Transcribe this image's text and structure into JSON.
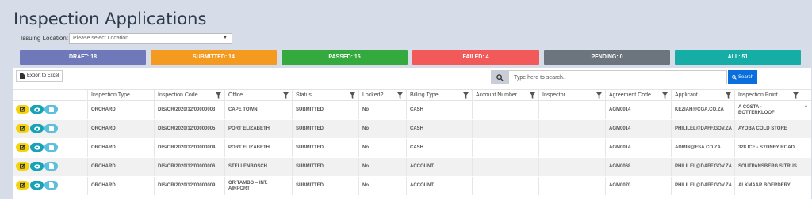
{
  "page": {
    "title": "Inspection Applications"
  },
  "filters": {
    "issuing_location_label": "Issuing Location:",
    "issuing_location_placeholder": "Please select Location"
  },
  "summary_cards": [
    {
      "label": "DRAFT: 18",
      "color": "#6f78b9"
    },
    {
      "label": "SUBMITTED: 14",
      "color": "#f49b1f"
    },
    {
      "label": "PASSED: 15",
      "color": "#33a93e"
    },
    {
      "label": "FAILED: 4",
      "color": "#f25a5a"
    },
    {
      "label": "PENDING: 0",
      "color": "#6c757d"
    },
    {
      "label": "ALL: 51",
      "color": "#15ada5"
    }
  ],
  "toolbar": {
    "export_label": "Export to Excel",
    "search_placeholder": "Type here to search..",
    "search_button_label": "Search"
  },
  "table": {
    "columns": [
      {
        "label": "Inspection Type",
        "filter": false
      },
      {
        "label": "Inspection Code",
        "filter": true
      },
      {
        "label": "Office",
        "filter": true
      },
      {
        "label": "Status",
        "filter": true
      },
      {
        "label": "Locked?",
        "filter": true
      },
      {
        "label": "Billing Type",
        "filter": true
      },
      {
        "label": "Account Number",
        "filter": true
      },
      {
        "label": "Inspector",
        "filter": true
      },
      {
        "label": "Agreement Code",
        "filter": true
      },
      {
        "label": "Applicant",
        "filter": true
      },
      {
        "label": "Inspection Point",
        "filter": true
      }
    ],
    "rows": [
      [
        "ORCHARD",
        "DIS/OR/2020/12/00000003",
        "CAPE TOWN",
        "SUBMITTED",
        "No",
        "CASH",
        "",
        "",
        "AGM0014",
        "KEZIAH@CGA.CO.ZA",
        "A COSTA - BOTTERKLOOF"
      ],
      [
        "ORCHARD",
        "DIS/OR/2020/12/00000005",
        "PORT ELIZABETH",
        "SUBMITTED",
        "No",
        "CASH",
        "",
        "",
        "AGM0014",
        "PHILILEL@DAFF.GOV.ZA",
        "AYOBA COLD STORE"
      ],
      [
        "ORCHARD",
        "DIS/OR/2020/12/00000004",
        "PORT ELIZABETH",
        "SUBMITTED",
        "No",
        "CASH",
        "",
        "",
        "AGM0014",
        "ADMIN@FSA.CO.ZA",
        "328 ICE - SYDNEY ROAD"
      ],
      [
        "ORCHARD",
        "DIS/OR/2020/12/00000006",
        "STELLENBOSCH",
        "SUBMITTED",
        "No",
        "ACCOUNT",
        "",
        "",
        "AGM0068",
        "PHILILEL@DAFF.GOV.ZA",
        "SOUTPANSBERG SITRUS"
      ],
      [
        "ORCHARD",
        "DIS/OR/2020/12/00000009",
        "OR TAMBO – INT. AIRPORT",
        "SUBMITTED",
        "No",
        "ACCOUNT",
        "",
        "",
        "AGM0070",
        "PHILILEL@DAFF.GOV.ZA",
        "ALKMAAR BOERDERY"
      ]
    ]
  }
}
